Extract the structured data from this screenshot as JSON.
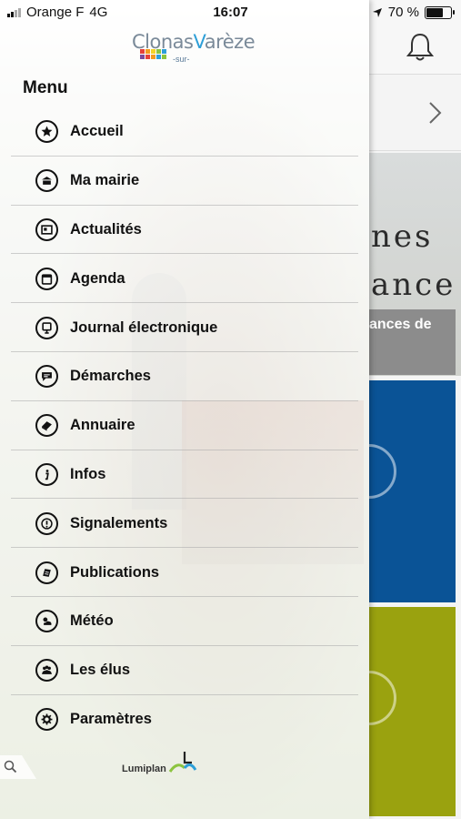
{
  "status_bar": {
    "carrier": "Orange F",
    "network": "4G",
    "time": "16:07",
    "battery": "70 %",
    "battery_level": 0.7
  },
  "logo": {
    "main": "Clonas",
    "v": "V",
    "rest": "arèze",
    "sub": "-sur-"
  },
  "menu": {
    "title": "Menu",
    "items": [
      {
        "label": "Accueil",
        "icon": "star-icon"
      },
      {
        "label": "Ma mairie",
        "icon": "town-hall-icon"
      },
      {
        "label": "Actualités",
        "icon": "news-icon"
      },
      {
        "label": "Agenda",
        "icon": "calendar-icon"
      },
      {
        "label": "Journal électronique",
        "icon": "screen-icon"
      },
      {
        "label": "Démarches",
        "icon": "chat-icon"
      },
      {
        "label": "Annuaire",
        "icon": "book-icon"
      },
      {
        "label": "Infos",
        "icon": "info-icon"
      },
      {
        "label": "Signalements",
        "icon": "alert-icon"
      },
      {
        "label": "Publications",
        "icon": "publication-icon"
      },
      {
        "label": "Météo",
        "icon": "weather-icon"
      },
      {
        "label": "Les élus",
        "icon": "people-icon"
      },
      {
        "label": "Paramètres",
        "icon": "gear-icon"
      }
    ]
  },
  "footer": {
    "brand": "Lumiplan"
  },
  "background": {
    "heading_line1": "nes",
    "heading_line2": "ance",
    "banner_text": "ances de"
  },
  "colors": {
    "blue_tile": "#0a5396",
    "olive_tile": "#9aa20f",
    "logo_blue": "#2d9fd8"
  }
}
